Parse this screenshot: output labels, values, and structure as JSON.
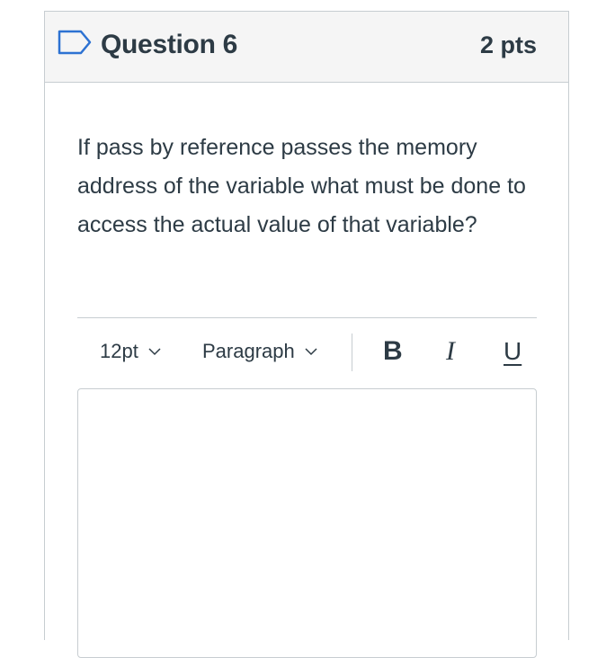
{
  "question": {
    "title": "Question 6",
    "points": "2 pts",
    "flag_icon": "flag-outline-icon",
    "text": "If pass by reference passes the memory address of the variable what must be done to access the actual value of that variable?"
  },
  "toolbar": {
    "font_size": "12pt",
    "block_format": "Paragraph",
    "bold_label": "B",
    "italic_label": "I",
    "underline_label": "U"
  },
  "editor": {
    "value": ""
  },
  "colors": {
    "header_bg": "#f5f5f5",
    "border": "#c7cdd1",
    "text": "#2d3b45",
    "flag": "#2d72d2"
  }
}
